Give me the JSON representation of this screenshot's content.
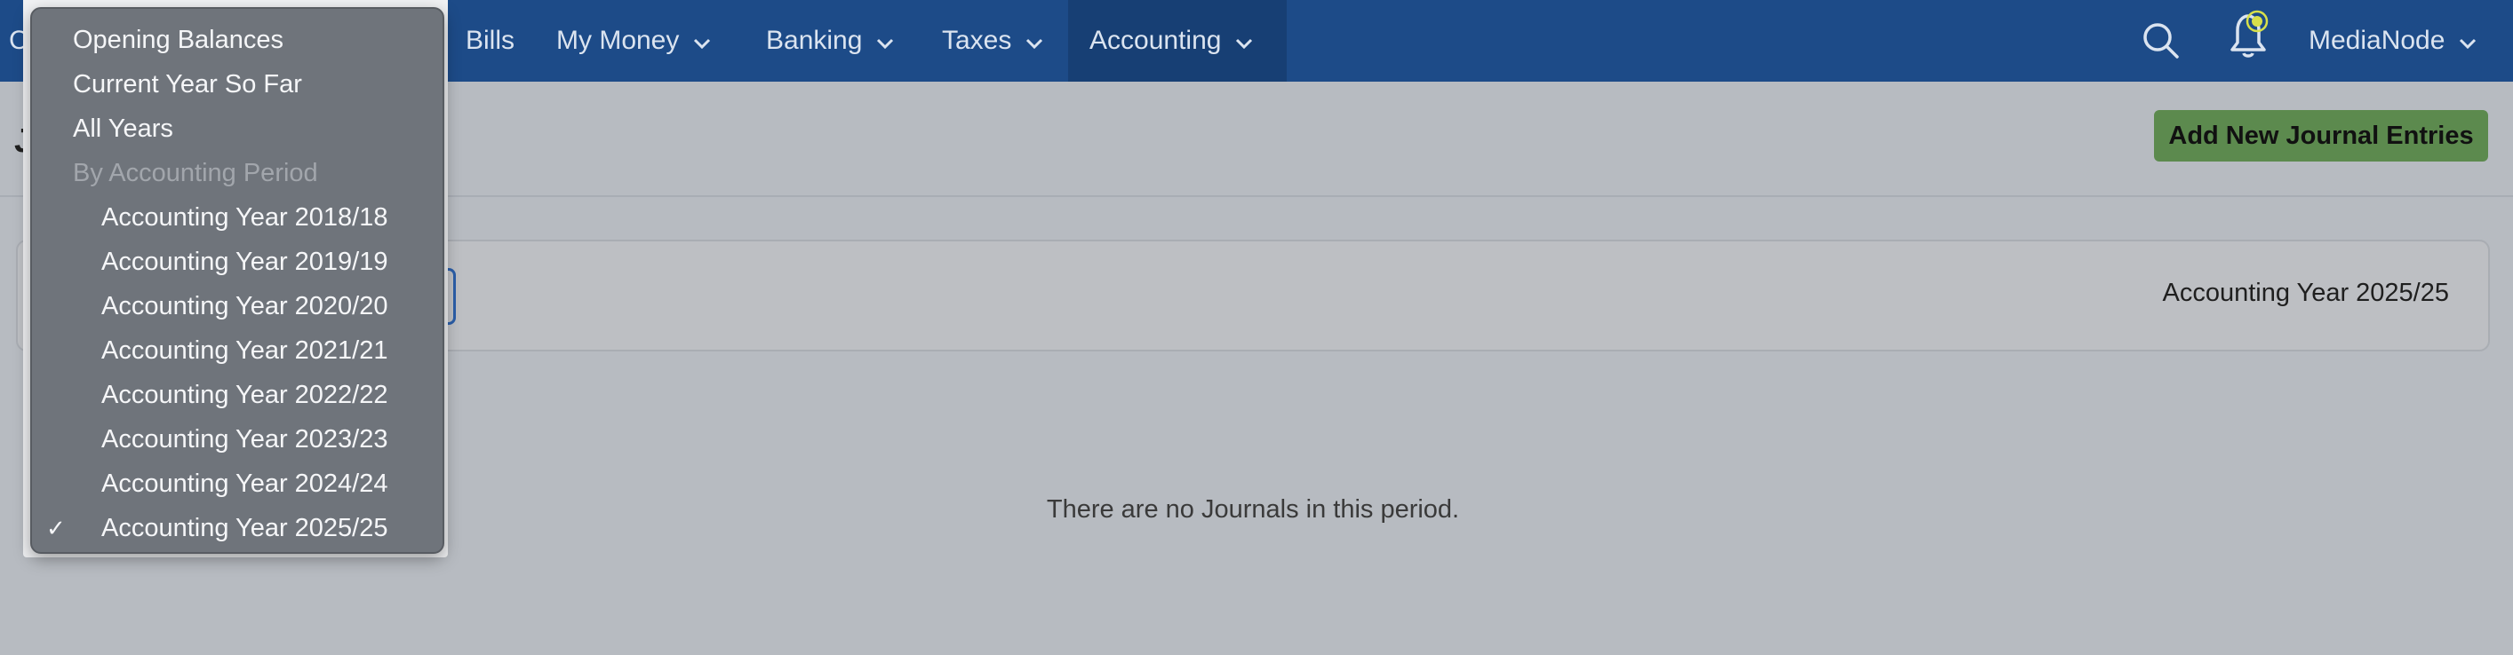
{
  "nav": {
    "stub": "C",
    "items": [
      {
        "label": "Bills",
        "has_chevron": false
      },
      {
        "label": "My Money",
        "has_chevron": true
      },
      {
        "label": "Banking",
        "has_chevron": true
      },
      {
        "label": "Taxes",
        "has_chevron": true
      },
      {
        "label": "Accounting",
        "has_chevron": true,
        "active": true
      }
    ],
    "account": "MediaNode"
  },
  "page": {
    "title_initial": "J",
    "add_button": "Add New Journal Entries",
    "period_label": "Accounting Year 2025/25",
    "empty_message": "There are no Journals in this period."
  },
  "dropdown": {
    "top_items": [
      "Opening Balances",
      "Current Year So Far",
      "All Years"
    ],
    "group_label": "By Accounting Period",
    "periods": [
      "Accounting Year 2018/18",
      "Accounting Year 2019/19",
      "Accounting Year 2020/20",
      "Accounting Year 2021/21",
      "Accounting Year 2022/22",
      "Accounting Year 2023/23",
      "Accounting Year 2024/24",
      "Accounting Year 2025/25"
    ],
    "selected": "Accounting Year 2025/25",
    "check_mark": "✓"
  },
  "colors": {
    "nav_bg": "#1d4b88",
    "nav_active": "#173f74",
    "add_button": "#5c8a4e",
    "notification_dot": "#d8e04a"
  }
}
